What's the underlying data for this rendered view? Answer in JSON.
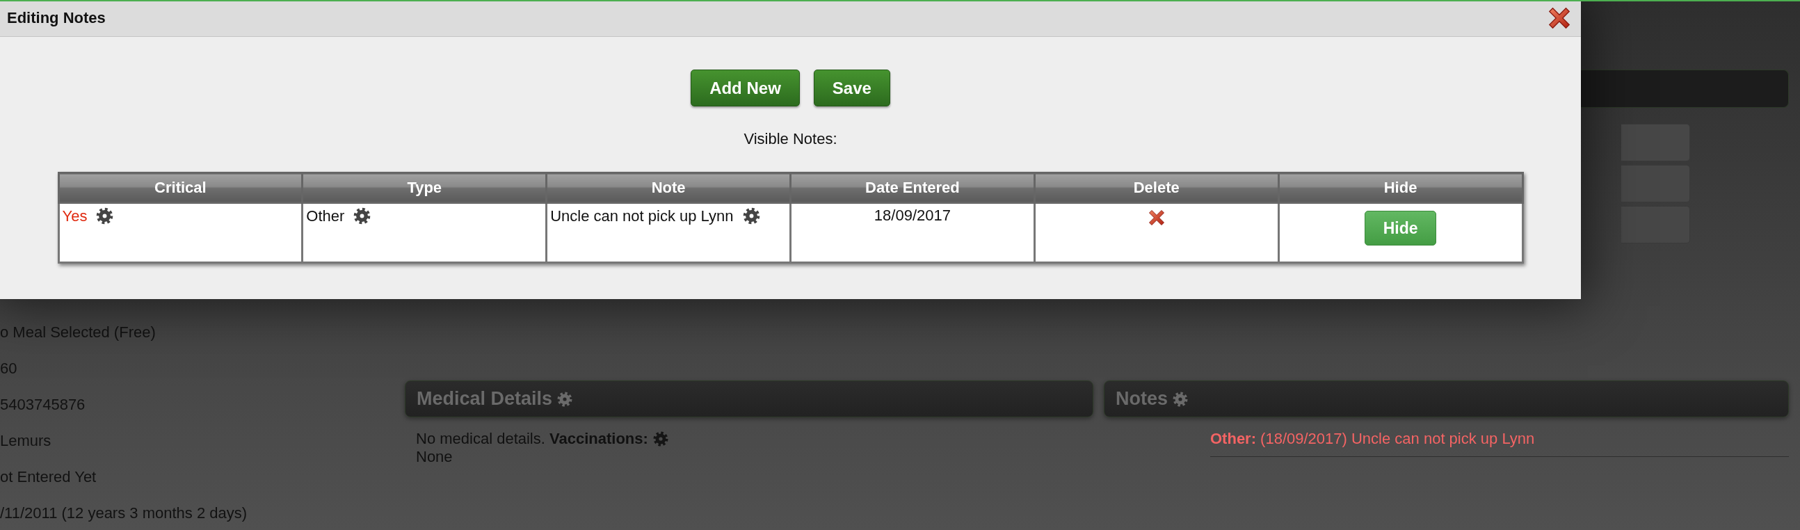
{
  "dialog": {
    "title": "Editing Notes",
    "buttons": [
      "Add New",
      "Save"
    ],
    "caption": "Visible Notes:",
    "table": {
      "columns": [
        "Critical",
        "Type",
        "Note",
        "Date Entered",
        "Delete",
        "Hide"
      ],
      "rows": [
        {
          "critical": "Yes",
          "type": "Other",
          "note": "Uncle can not pick up Lynn",
          "date_entered": "18/09/2017",
          "hide_button": "Hide"
        }
      ]
    }
  },
  "background": {
    "details": [
      "o Meal Selected (Free)",
      "60",
      "5403745876",
      "Lemurs",
      "ot Entered Yet",
      "/11/2011 (12 years 3 months 2 days)"
    ],
    "medical": {
      "title": "Medical Details",
      "text": "No medical details. **Vaccinations:**",
      "value": "None"
    },
    "notes": {
      "title": "Notes",
      "items": [
        "**Other:** (18/09/2017) Uncle can not pick up Lynn"
      ]
    }
  }
}
